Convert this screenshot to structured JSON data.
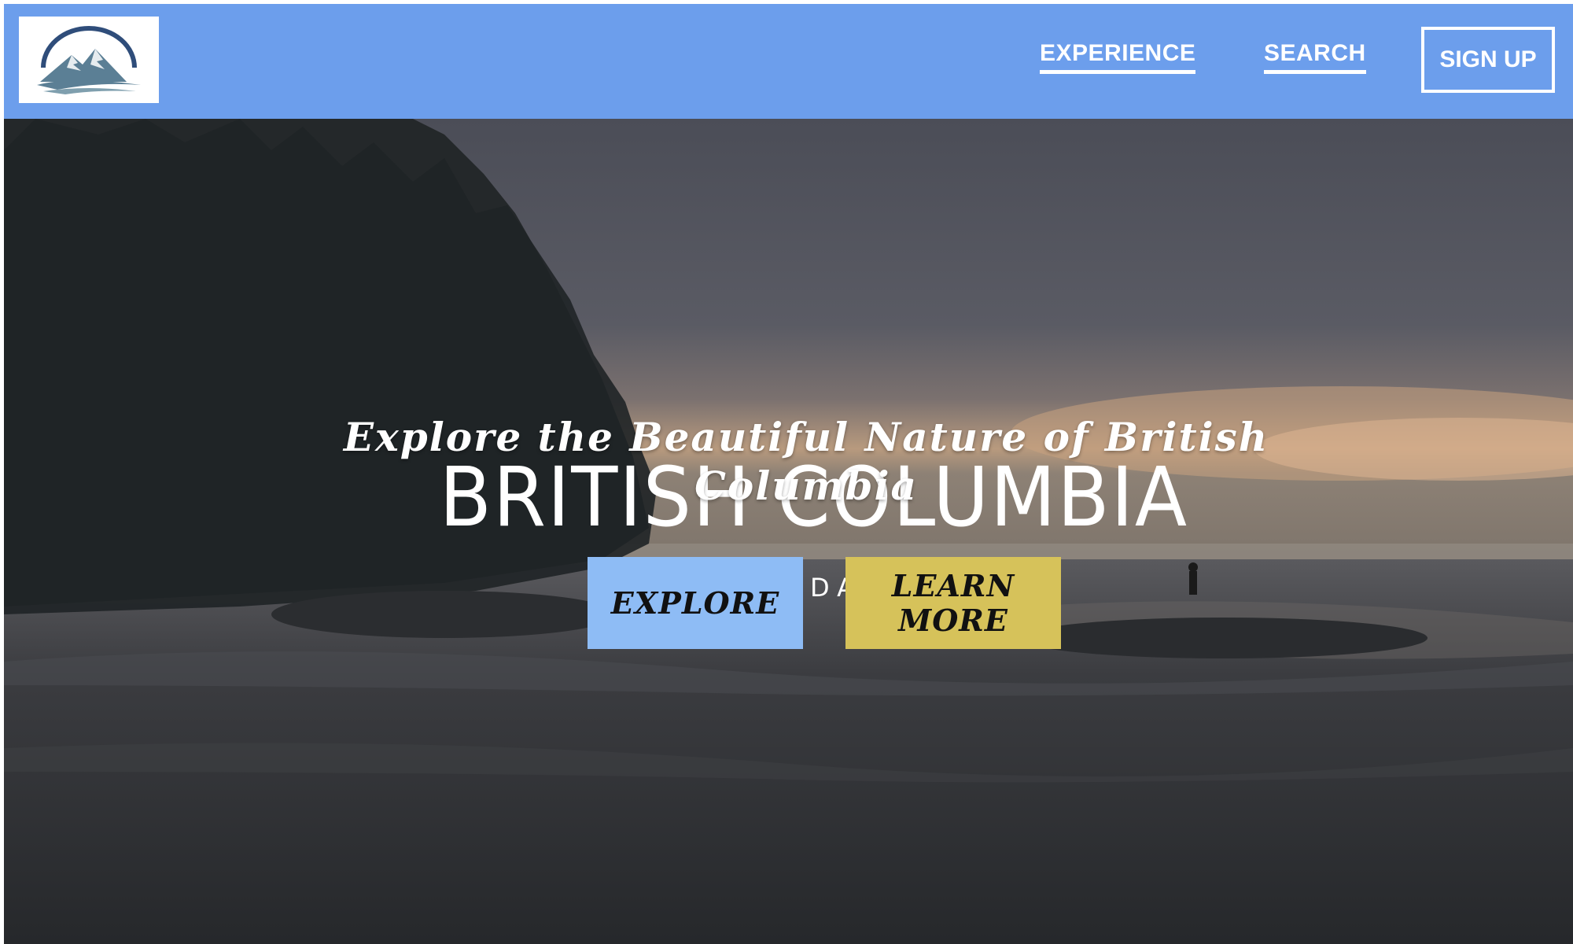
{
  "nav": {
    "logo_icon": "mountain-logo-icon",
    "links": [
      {
        "label": "EXPERIENCE"
      },
      {
        "label": "SEARCH"
      }
    ],
    "signup_label": "SIGN UP"
  },
  "hero": {
    "title": "Explore the Beautiful Nature of British Columbia",
    "background_caption": "BRITISH COLUMBIA",
    "background_subcaption": "DA",
    "explore_label": "EXPLORE",
    "learn_more_label": "LEARN MORE"
  },
  "colors": {
    "navbar": "#6c9eec",
    "explore_button": "#8ebcf5",
    "learn_more_button": "#d6c25a"
  }
}
